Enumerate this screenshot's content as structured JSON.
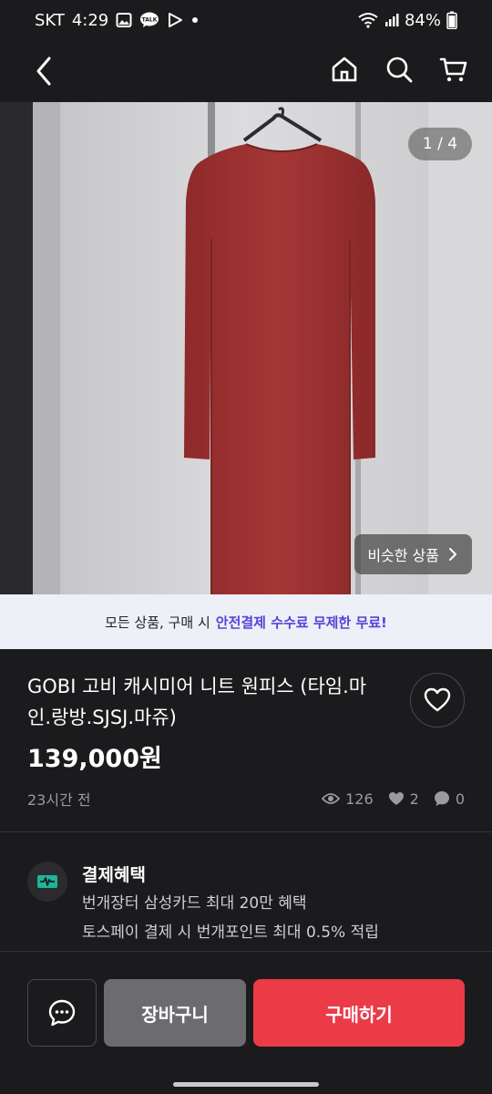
{
  "status_bar": {
    "carrier": "SKT",
    "time": "4:29",
    "battery": "84%",
    "icons": [
      "gallery-icon",
      "talk-icon",
      "play-icon",
      "dot-icon",
      "wifi-icon",
      "signal-icon",
      "battery-icon"
    ]
  },
  "nav": {
    "icons": [
      "back-icon",
      "home-icon",
      "search-icon",
      "cart-icon"
    ]
  },
  "gallery": {
    "counter": "1 / 4",
    "similar_label": "비슷한 상품"
  },
  "banner": {
    "text": "모든 상품, 구매 시",
    "highlight": "안전결제 수수료 무제한 무료!",
    "highlight_color": "#5a3fd8"
  },
  "product": {
    "title": "GOBI 고비 캐시미어 니트 원피스 (타임.마인.랑방.SJSJ.마쥬)",
    "price": "139,000원",
    "posted": "23시간 전",
    "views": "126",
    "likes": "2",
    "comments": "0"
  },
  "benefit": {
    "title": "결제혜택",
    "lines": [
      "번개장터 삼성카드 최대 20만 혜택",
      "토스페이 결제 시 번개포인트 최대 0.5% 적립"
    ]
  },
  "actions": {
    "cart_label": "장바구니",
    "buy_label": "구매하기",
    "buy_color": "#ea3b47"
  }
}
